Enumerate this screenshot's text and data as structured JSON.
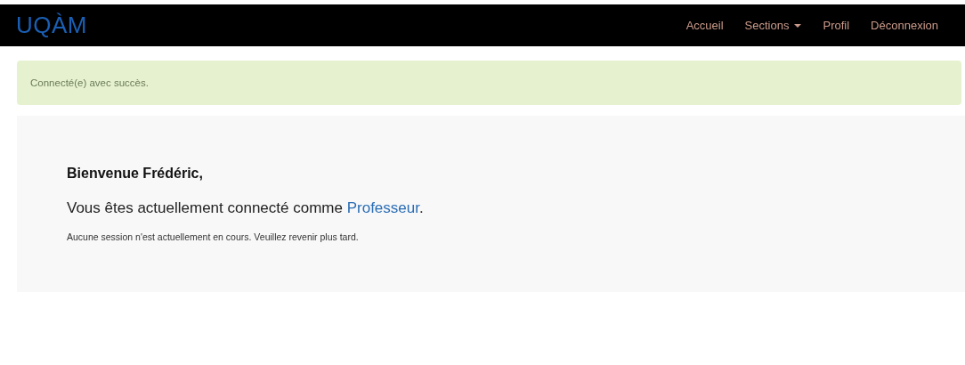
{
  "navbar": {
    "brand": "UQÀM",
    "items": [
      {
        "label": "Accueil",
        "dropdown": false
      },
      {
        "label": "Sections",
        "dropdown": true
      },
      {
        "label": "Profil",
        "dropdown": false
      },
      {
        "label": "Déconnexion",
        "dropdown": false
      }
    ]
  },
  "alert": {
    "kind": "success",
    "text": "Connecté(e) avec succès."
  },
  "welcome": {
    "heading": "Bienvenue Frédéric,",
    "role_before": "Vous êtes actuellement connecté comme ",
    "role": "Professeur",
    "role_after": ".",
    "notice": "Aucune session n'est actuellement en cours. Veuillez revenir plus tard."
  }
}
